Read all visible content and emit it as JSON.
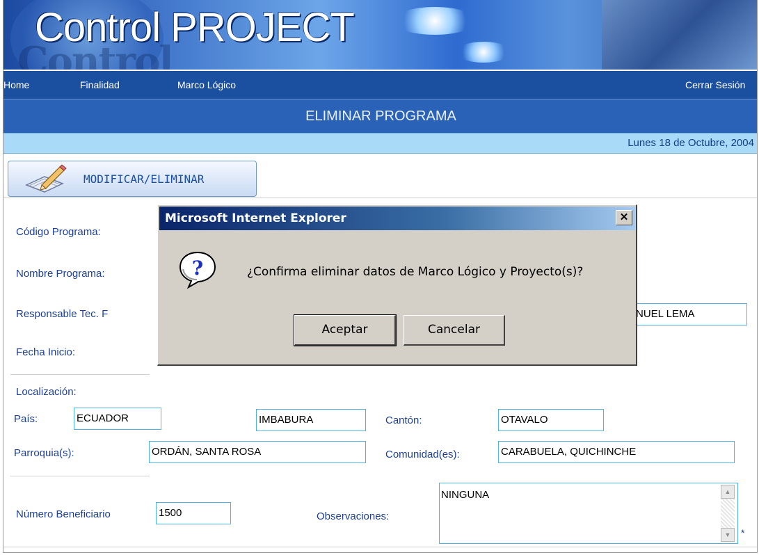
{
  "app": {
    "title": "Control PROJECT"
  },
  "nav": {
    "home": "Home",
    "finalidad": "Finalidad",
    "marco_logico": "Marco Lógico",
    "logout": "Cerrar Sesión"
  },
  "page": {
    "subtitle": "ELIMINAR PROGRAMA",
    "date": "Lunes 18 de Octubre, 2004",
    "tab": "MODIFICAR/ELIMINAR"
  },
  "form": {
    "codigo_label": "Código Programa:",
    "nombre_label": "Nombre Programa:",
    "responsable_label": "Responsable Tec. F",
    "responsable_value": "ANUEL LEMA",
    "fecha_label": "Fecha Inicio:",
    "localizacion_label": "Localización:",
    "pais_label": "País:",
    "pais_value": "ECUADOR",
    "provincia_value": "IMBABURA",
    "canton_label": "Cantón:",
    "canton_value": "OTAVALO",
    "parroquia_label": "Parroquia(s):",
    "parroquia_value": "ORDÁN, SANTA ROSA",
    "comunidad_label": "Comunidad(es):",
    "comunidad_value": "CARABUELA, QUICHINCHE",
    "beneficiario_label": "Número Beneficiario",
    "beneficiario_value": "1500",
    "observaciones_label": "Observaciones:",
    "observaciones_value": "NINGUNA",
    "required_mark": "*"
  },
  "dialog": {
    "title": "Microsoft Internet Explorer",
    "close": "✕",
    "message": "¿Confirma eliminar datos de Marco Lógico y Proyecto(s)?",
    "ok": "Aceptar",
    "cancel": "Cancelar"
  },
  "colors": {
    "nav": "#1b4fa0",
    "subtitle": "#2a62b7",
    "datebar": "#a9daf7",
    "label": "#1d3f96",
    "field_border": "#4fb2e8",
    "dialog_bg": "#d4d0c8"
  }
}
